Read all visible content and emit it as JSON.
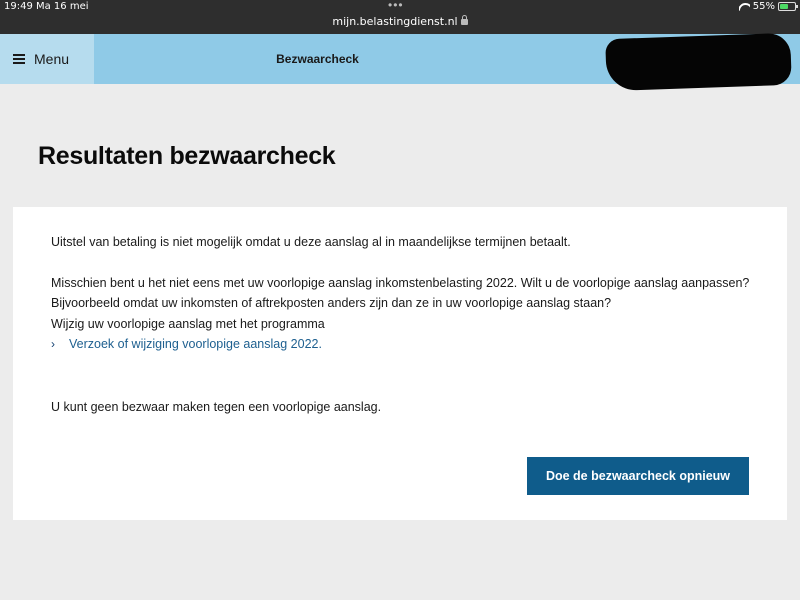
{
  "statusbar": {
    "time": "19:49",
    "date": "Ma 16 mei",
    "url": "mijn.belastingdienst.nl",
    "battery": "55%",
    "battery_level": 0.55
  },
  "header": {
    "menu_label": "Menu",
    "title": "Bezwaarcheck"
  },
  "page": {
    "title": "Resultaten bezwaarcheck",
    "text1": "Uitstel van betaling is niet mogelijk omdat u deze aanslag al in maandelijkse termijnen betaalt.",
    "text2": "Misschien bent u het niet eens met uw voorlopige aanslag inkomstenbelasting 2022. Wilt u de voorlopige aanslag aanpassen?",
    "text3": "Bijvoorbeeld omdat uw inkomsten of aftrekposten anders zijn dan ze in uw voorlopige aanslag staan?",
    "text4": "Wijzig uw voorlopige aanslag met het programma",
    "link_label": "Verzoek of wijziging voorlopige aanslag 2022.",
    "text5": "U kunt geen bezwaar maken tegen een voorlopige aanslag.",
    "button_label": "Doe de bezwaarcheck opnieuw"
  },
  "colors": {
    "header_bg": "#8fcae7",
    "menu_bg": "#b6dcee",
    "button_bg": "#0f5c8b",
    "link": "#1d5f8f"
  }
}
